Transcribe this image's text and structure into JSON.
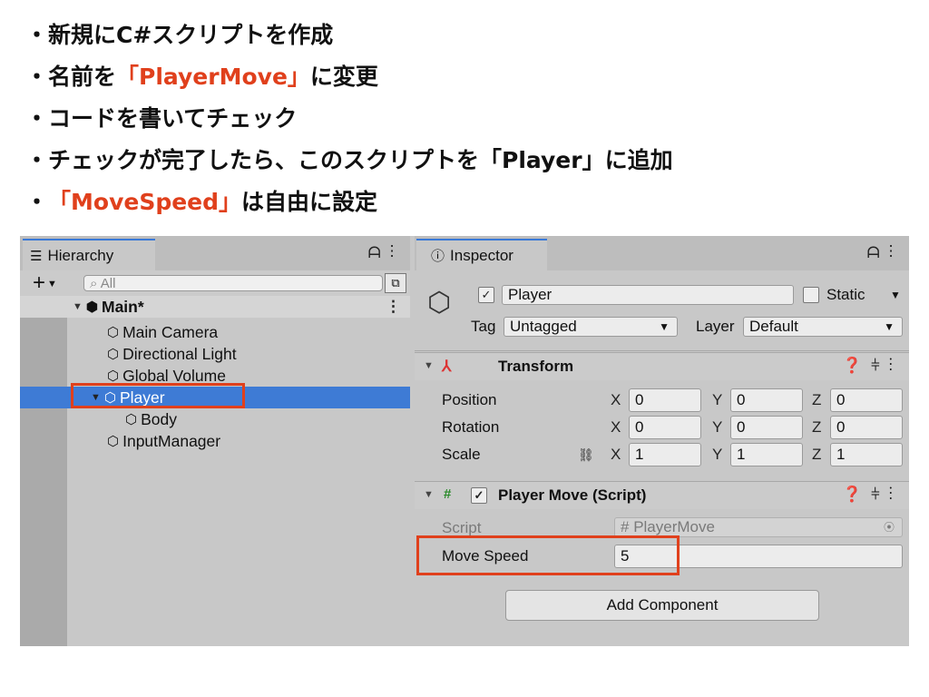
{
  "bullets": [
    {
      "prefix": "・新規にC#スクリプトを作成",
      "highlight": "",
      "suffix": ""
    },
    {
      "prefix": "・名前を",
      "highlight": "「PlayerMove」",
      "suffix": "に変更"
    },
    {
      "prefix": "・コードを書いてチェック",
      "highlight": "",
      "suffix": ""
    },
    {
      "prefix": "・チェックが完了したら、このスクリプトを「Player」に追加",
      "highlight": "",
      "suffix": ""
    },
    {
      "prefix": "・",
      "highlight": "「MoveSpeed」",
      "suffix": "は自由に設定"
    }
  ],
  "colors": {
    "highlight": "#e0401c",
    "selection": "#3e7bd5"
  },
  "hierarchy": {
    "tab_label": "Hierarchy",
    "search_placeholder": "All",
    "scene": "Main*",
    "items": [
      "Main Camera",
      "Directional Light",
      "Global Volume",
      "Player",
      "Body",
      "InputManager"
    ]
  },
  "inspector": {
    "tab_label": "Inspector",
    "object_name": "Player",
    "static_label": "Static",
    "tag_label": "Tag",
    "tag_value": "Untagged",
    "layer_label": "Layer",
    "layer_value": "Default",
    "transform": {
      "title": "Transform",
      "position": {
        "label": "Position",
        "x": "0",
        "y": "0",
        "z": "0"
      },
      "rotation": {
        "label": "Rotation",
        "x": "0",
        "y": "0",
        "z": "0"
      },
      "scale": {
        "label": "Scale",
        "x": "1",
        "y": "1",
        "z": "1"
      }
    },
    "script_component": {
      "title": "Player Move (Script)",
      "script_label": "Script",
      "script_value": "PlayerMove",
      "move_speed_label": "Move Speed",
      "move_speed_value": "5"
    },
    "add_component_label": "Add Component"
  },
  "axis_labels": {
    "x": "X",
    "y": "Y",
    "z": "Z"
  }
}
